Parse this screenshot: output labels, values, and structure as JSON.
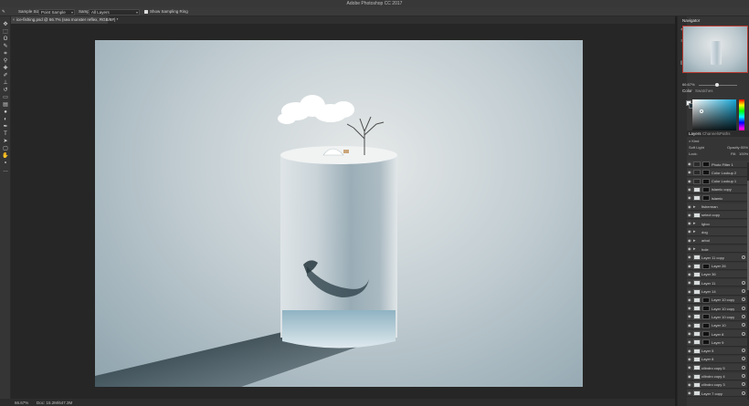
{
  "app": {
    "title": "Adobe Photoshop CC 2017"
  },
  "options_bar": {
    "sample_size_label": "Sample Size:",
    "sample_size_value": "Point Sample",
    "sample_label": "Sample:",
    "sample_value": "All Layers",
    "show_sampling_ring": "Show Sampling Ring"
  },
  "document": {
    "tab_label": "ice-fishing.psd @ 66.7% (sea monster reflex, RGB/8#) *"
  },
  "status": {
    "zoom": "66.67%",
    "doc_info": "Doc: 15.2M/647.3M"
  },
  "navigator": {
    "title": "Navigator",
    "zoom": "66.67%"
  },
  "color_panel": {
    "tab_color": "Color",
    "tab_swatches": "Swatches",
    "fg": "#e8eef0",
    "bg": "#23343c",
    "accent": "#17a7d6"
  },
  "layers_panel": {
    "tabs": [
      "Layers",
      "Channels",
      "Paths"
    ],
    "kind_label": "Kind",
    "blend_mode": "Soft Light",
    "opacity_label": "Opacity:",
    "opacity_value": "55%",
    "lock_label": "Lock:",
    "fill_label": "Fill:",
    "fill_value": "100%",
    "layers": [
      {
        "name": "Photo Filter 1",
        "type": "adj",
        "mask": true
      },
      {
        "name": "Color Lookup 2",
        "type": "adj",
        "mask": true
      },
      {
        "name": "Color Lookup 1",
        "type": "adj",
        "mask": true
      },
      {
        "name": "islamic copy",
        "type": "img",
        "mask": true
      },
      {
        "name": "islamic",
        "type": "img",
        "mask": true
      },
      {
        "name": "fisherman",
        "type": "folder",
        "mask": false
      },
      {
        "name": "select copy",
        "type": "img",
        "mask": false
      },
      {
        "name": "Igloo",
        "type": "folder",
        "mask": false
      },
      {
        "name": "dog",
        "type": "folder",
        "mask": false
      },
      {
        "name": "arbol",
        "type": "folder",
        "mask": false
      },
      {
        "name": "hole",
        "type": "folder",
        "mask": false
      },
      {
        "name": "Layer 11 copy",
        "type": "img",
        "mask": false,
        "fx": true
      },
      {
        "name": "Layer 26",
        "type": "img",
        "mask": true
      },
      {
        "name": "Layer 36",
        "type": "img",
        "mask": false
      },
      {
        "name": "Layer 11",
        "type": "img",
        "mask": false,
        "fx": true
      },
      {
        "name": "Layer 14",
        "type": "img",
        "mask": false,
        "fx": true
      },
      {
        "name": "Layer 10 copy",
        "type": "img",
        "mask": true,
        "fx": true
      },
      {
        "name": "Layer 10 copy",
        "type": "img",
        "mask": true,
        "fx": true
      },
      {
        "name": "Layer 10 copy",
        "type": "img",
        "mask": true,
        "fx": true
      },
      {
        "name": "Layer 10",
        "type": "img",
        "mask": true,
        "fx": true
      },
      {
        "name": "Layer 8",
        "type": "img",
        "mask": true,
        "fx": true
      },
      {
        "name": "Layer 9",
        "type": "img",
        "mask": true
      },
      {
        "name": "Layer 5",
        "type": "img",
        "mask": false,
        "fx": true
      },
      {
        "name": "Layer 8",
        "type": "img",
        "mask": false,
        "fx": true
      },
      {
        "name": "cilindro copy 5",
        "type": "img",
        "mask": false,
        "fx": true
      },
      {
        "name": "cilindro copy 4",
        "type": "img",
        "mask": false,
        "fx": true
      },
      {
        "name": "cilindro copy 3",
        "type": "img",
        "mask": false,
        "fx": true
      },
      {
        "name": "Layer 7 copy",
        "type": "img",
        "mask": false,
        "fx": true
      }
    ]
  },
  "tools": [
    {
      "icon": "move-icon",
      "glyph": "✥"
    },
    {
      "icon": "marquee-icon",
      "glyph": "⬚"
    },
    {
      "icon": "lasso-icon",
      "glyph": "ʘ"
    },
    {
      "icon": "quick-select-icon",
      "glyph": "✎"
    },
    {
      "icon": "crop-icon",
      "glyph": "⌗"
    },
    {
      "icon": "eyedropper-icon",
      "glyph": "⚲"
    },
    {
      "icon": "healing-icon",
      "glyph": "✚"
    },
    {
      "icon": "brush-icon",
      "glyph": "✐"
    },
    {
      "icon": "stamp-icon",
      "glyph": "⊥"
    },
    {
      "icon": "history-brush-icon",
      "glyph": "↺"
    },
    {
      "icon": "eraser-icon",
      "glyph": "▭"
    },
    {
      "icon": "gradient-icon",
      "glyph": "▤"
    },
    {
      "icon": "blur-icon",
      "glyph": "●"
    },
    {
      "icon": "dodge-icon",
      "glyph": "◐"
    },
    {
      "icon": "pen-icon",
      "glyph": "✒"
    },
    {
      "icon": "type-icon",
      "glyph": "T"
    },
    {
      "icon": "path-select-icon",
      "glyph": "➤"
    },
    {
      "icon": "shape-icon",
      "glyph": "▢"
    },
    {
      "icon": "hand-icon",
      "glyph": "✋"
    },
    {
      "icon": "zoom-icon",
      "glyph": "⚬"
    },
    {
      "icon": "more-icon",
      "glyph": "…"
    }
  ]
}
